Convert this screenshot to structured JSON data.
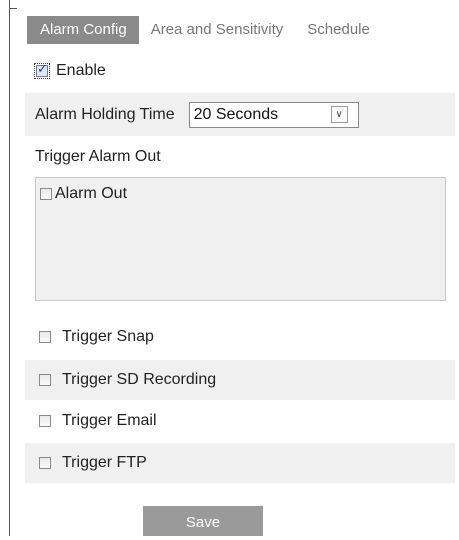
{
  "tabs": [
    {
      "label": "Alarm Config",
      "active": true
    },
    {
      "label": "Area and Sensitivity",
      "active": false
    },
    {
      "label": "Schedule",
      "active": false
    }
  ],
  "enable": {
    "label": "Enable",
    "checked": true
  },
  "holding_time": {
    "label": "Alarm Holding Time",
    "value": "20 Seconds"
  },
  "trigger_alarm_out": {
    "heading": "Trigger Alarm Out",
    "alarm_out_label": "Alarm Out",
    "alarm_out_checked": false
  },
  "triggers": {
    "snap": "Trigger Snap",
    "sd_recording": "Trigger SD Recording",
    "email": "Trigger Email",
    "ftp": "Trigger FTP"
  },
  "save_label": "Save"
}
